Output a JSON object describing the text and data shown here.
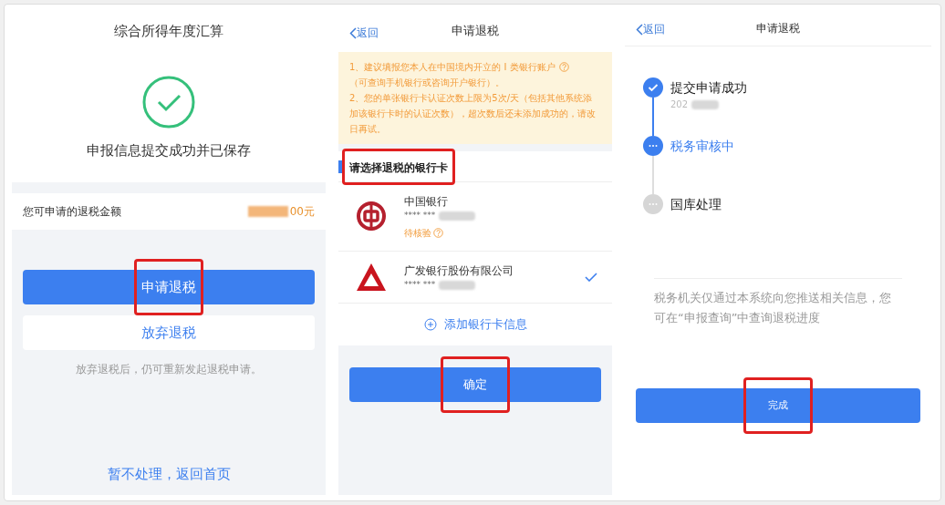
{
  "summary_screen": {
    "title": "综合所得年度汇算",
    "message": "申报信息提交成功并已保存",
    "amount_label": "您可申请的退税金额",
    "amount_value": "00元",
    "apply_button": {
      "label": "申请退税",
      "highlighted": true
    },
    "abandon_button": {
      "label": "放弃退税"
    },
    "note": "放弃退税后，仍可重新发起退税申请。",
    "home_link": "暂不处理，返回首页"
  },
  "bank_screen": {
    "back": "返回",
    "title": "申请退税",
    "notices": [
      "1、建议填报您本人在中国境内开立的 I 类银行账户",
      "（可查询手机银行或咨询开户银行）。",
      "2、您的单张银行卡认证次数上限为5次/天（包括其他系统添加该银行卡时的认证次数），超次数后还未添加成功的，请改日再试。"
    ],
    "section_title": {
      "label": "请选择退税的银行卡",
      "highlighted": true
    },
    "cards": [
      {
        "name": "中国银行",
        "number": "**** ***",
        "status": "待核验",
        "selected": false,
        "kind": "ring"
      },
      {
        "name": "广发银行股份有限公司",
        "number": "**** ***",
        "selected": true,
        "kind": "triangle"
      }
    ],
    "add_card": "添加银行卡信息",
    "confirm_button": {
      "label": "确定",
      "highlighted": true
    }
  },
  "status_screen": {
    "back": "返回",
    "title": "申请退税",
    "steps": [
      {
        "label": "提交申请成功",
        "date": "202",
        "kind": "done"
      },
      {
        "label": "税务审核中",
        "kind": "current"
      },
      {
        "label": "国库处理",
        "kind": "pending"
      }
    ],
    "info": "税务机关仅通过本系统向您推送相关信息，您可在“申报查询”中查询退税进度",
    "done_button": {
      "label": "完成",
      "highlighted": true
    }
  }
}
